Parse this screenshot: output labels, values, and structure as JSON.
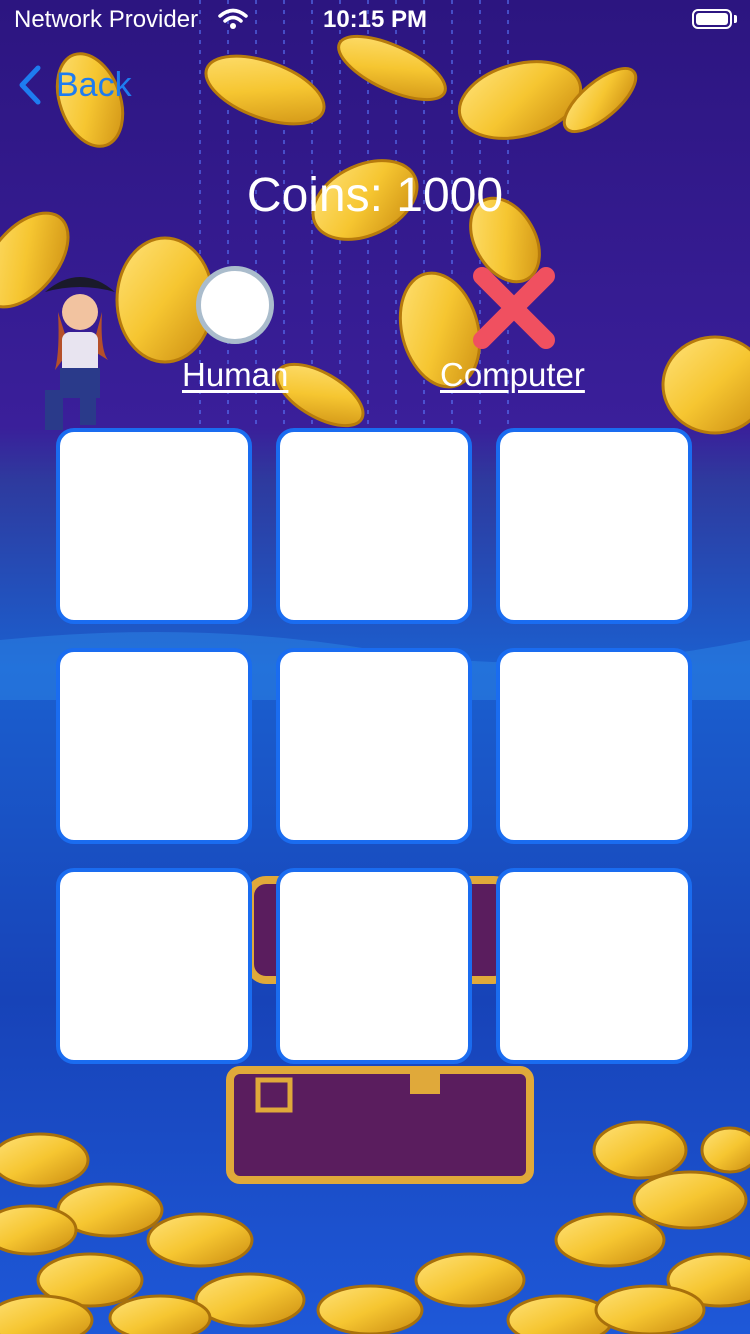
{
  "status_bar": {
    "carrier": "Network Provider",
    "time": "10:15 PM",
    "wifi_icon": "wifi-icon",
    "battery_icon": "battery-icon",
    "battery_level": 1.0
  },
  "nav": {
    "back_label": "Back",
    "back_icon": "chevron-left-icon"
  },
  "coins_text": "Coins: 1000",
  "players": {
    "human": {
      "label": "Human",
      "symbol": "circle-icon"
    },
    "computer": {
      "label": "Computer",
      "symbol": "cross-icon"
    }
  },
  "board": {
    "rows": 3,
    "cols": 3,
    "cells": [
      "",
      "",
      "",
      "",
      "",
      "",
      "",
      "",
      ""
    ]
  },
  "colors": {
    "accent": "#1e7cf0",
    "cell_border": "#1a6cf0",
    "cross": "#f05060",
    "coin_gold": "#f6c631",
    "background_top": "#2a1580",
    "background_water": "#1a4fd0"
  }
}
